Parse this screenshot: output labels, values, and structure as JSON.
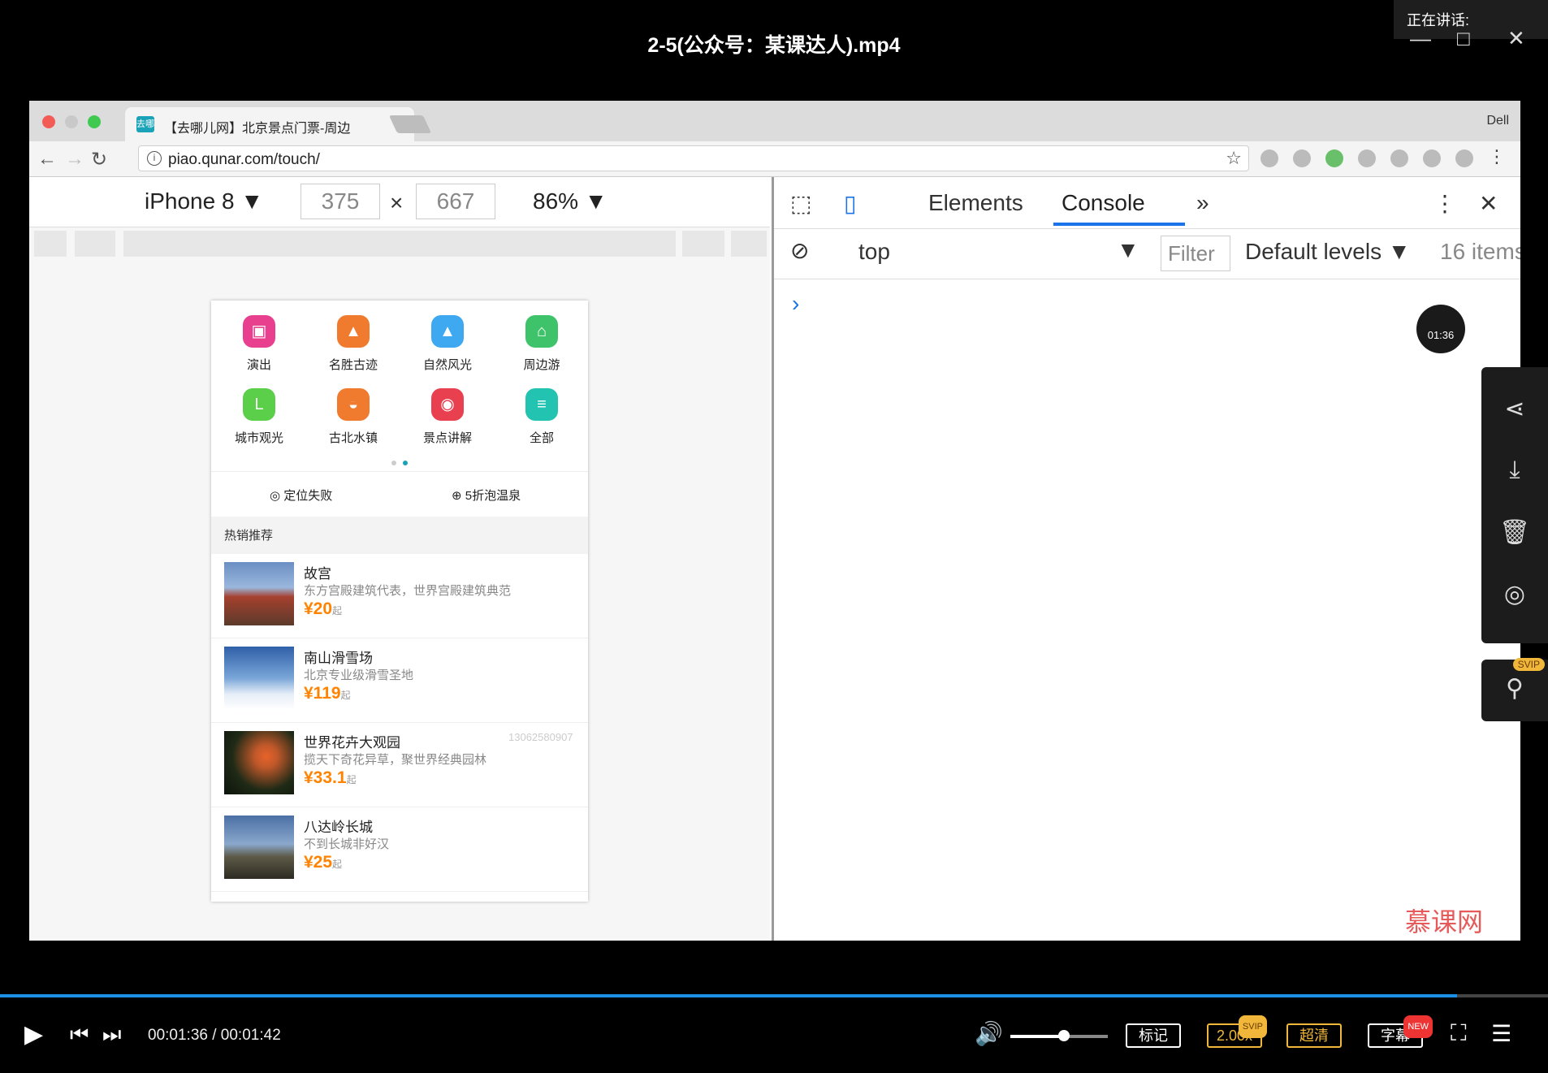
{
  "player": {
    "title": "2-5(公众号：某课达人).mp4",
    "speaking_label": "正在讲话:",
    "window_controls": {
      "minimize": "—",
      "maximize": "□",
      "close": "✕"
    },
    "side_tools": [
      "share-icon",
      "download-icon",
      "delete-icon",
      "target-icon"
    ],
    "pin_badge": "SVIP",
    "timer_label": "01:36",
    "brand": "慕课网",
    "controls": {
      "current_time": "00:01:36",
      "total_time": "00:01:42",
      "time_text": "00:01:36 / 00:01:42",
      "progress": 0.941,
      "volume": 0.55,
      "mark_label": "标记",
      "speed_label": "2.00x",
      "speed_badge": "SVIP",
      "quality_label": "超清",
      "subtitle_label": "字幕",
      "subtitle_badge": "NEW"
    }
  },
  "browser": {
    "tab_title": "【去哪儿网】北京景点门票-周边",
    "tab_favicon": "去哪",
    "profile": "Dell",
    "url": "piao.qunar.com/touch/"
  },
  "device_toolbar": {
    "device": "iPhone 8",
    "width": "375",
    "height": "667",
    "zoom": "86%"
  },
  "mobile_page": {
    "categories": [
      {
        "label": "演出",
        "color": "#e8408f",
        "icon": "ticket-icon"
      },
      {
        "label": "名胜古迹",
        "color": "#f07a2e",
        "icon": "temple-icon"
      },
      {
        "label": "自然风光",
        "color": "#3ea8f0",
        "icon": "mountain-icon"
      },
      {
        "label": "周边游",
        "color": "#3fc36a",
        "icon": "bag-icon"
      },
      {
        "label": "城市观光",
        "color": "#5ccf4a",
        "icon": "city-icon"
      },
      {
        "label": "古北水镇",
        "color": "#f07a2e",
        "icon": "boat-icon"
      },
      {
        "label": "景点讲解",
        "color": "#e8404f",
        "icon": "speaker-icon"
      },
      {
        "label": "全部",
        "color": "#22c3b0",
        "icon": "list-icon"
      }
    ],
    "location": "定位失败",
    "promo": "5折泡温泉",
    "hot_title": "热销推荐",
    "items": [
      {
        "name": "故宫",
        "desc": "东方宫殿建筑代表，世界宫殿建筑典范",
        "price": "¥20",
        "unit": "起"
      },
      {
        "name": "南山滑雪场",
        "desc": "北京专业级滑雪圣地",
        "price": "¥119",
        "unit": "起"
      },
      {
        "name": "世界花卉大观园",
        "desc": "揽天下奇花异草，聚世界经典园林",
        "price": "¥33.1",
        "unit": "起",
        "watermark": "13062580907"
      },
      {
        "name": "八达岭长城",
        "desc": "不到长城非好汉",
        "price": "¥25",
        "unit": "起"
      }
    ]
  },
  "devtools": {
    "tabs": [
      "Elements",
      "Console"
    ],
    "more": "»",
    "context": "top",
    "filter_placeholder": "Filter",
    "levels": "Default levels ▼",
    "items_count": "16 items"
  }
}
